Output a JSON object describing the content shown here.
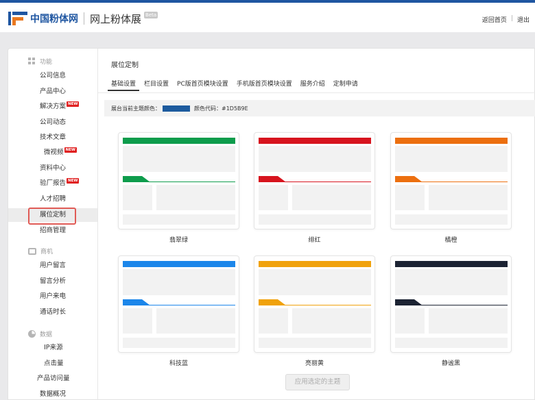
{
  "header": {
    "logo_text": "中国粉体网",
    "subtitle": "网上粉体展",
    "beta": "Beta",
    "links": [
      "返回首页",
      "退出"
    ],
    "link_sep": "|"
  },
  "sidebar": {
    "groups": [
      {
        "label": "功能",
        "icon": "grid-icon"
      },
      {
        "label": "商机",
        "icon": "tray-icon"
      },
      {
        "label": "数据",
        "icon": "pie-chart-icon"
      }
    ],
    "items": [
      {
        "label": "公司信息"
      },
      {
        "label": "产品中心"
      },
      {
        "label": "解决方案",
        "badge": "NEW"
      },
      {
        "label": "公司动态"
      },
      {
        "label": "技术文章"
      },
      {
        "label": "微视频",
        "badge": "NEW"
      },
      {
        "label": "资料中心"
      },
      {
        "label": "验厂报告",
        "badge": "NEW"
      },
      {
        "label": "人才招聘"
      },
      {
        "label": "展位定制"
      },
      {
        "label": "招商管理"
      },
      {
        "label": "用户留言"
      },
      {
        "label": "留言分析"
      },
      {
        "label": "用户来电"
      },
      {
        "label": "通话时长"
      },
      {
        "label": "IP来源"
      },
      {
        "label": "点击量"
      },
      {
        "label": "产品访问量"
      },
      {
        "label": "数据概况"
      }
    ]
  },
  "main": {
    "title": "展位定制",
    "tabs": [
      "基础设置",
      "栏目设置",
      "PC版首页模块设置",
      "手机版首页模块设置",
      "服务介绍",
      "定制申请"
    ],
    "current_color_label": "展台当前主题颜色：",
    "color_code_label": "颜色代码：",
    "color_code": "#1D5B9E",
    "themes": [
      {
        "name": "翡翠绿",
        "color": "#0e9c4c"
      },
      {
        "name": "绯红",
        "color": "#d7141e"
      },
      {
        "name": "橘橙",
        "color": "#ec6f0f"
      },
      {
        "name": "科技蓝",
        "color": "#1c86ea"
      },
      {
        "name": "亮丽黄",
        "color": "#f0a20c"
      },
      {
        "name": "静谧黑",
        "color": "#1c2333"
      }
    ],
    "apply_button": "应用选定的主题"
  }
}
